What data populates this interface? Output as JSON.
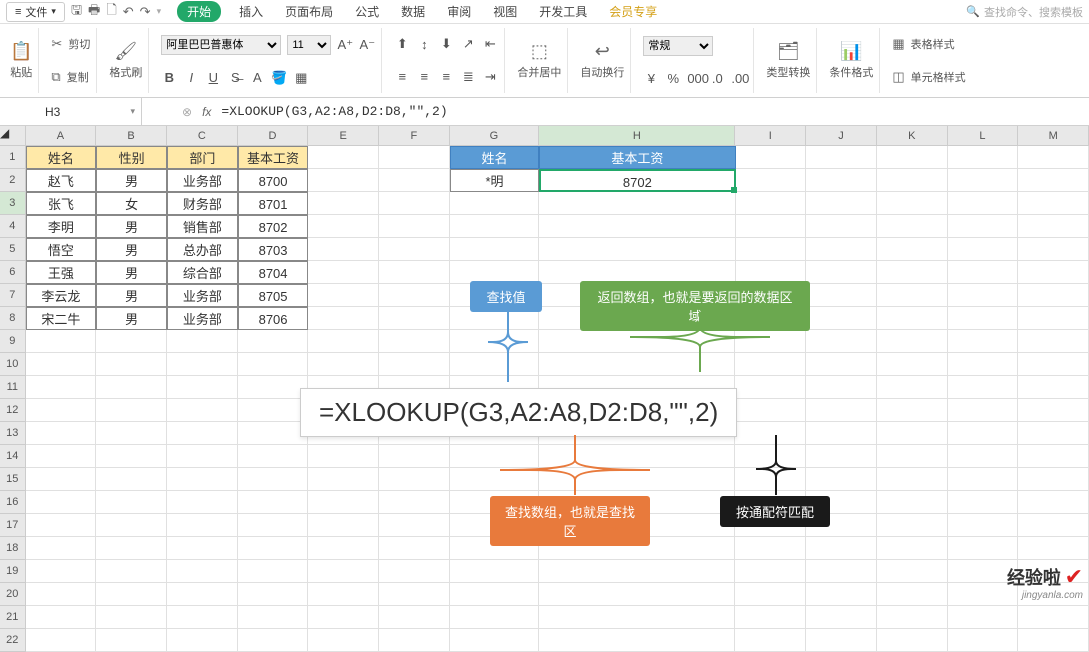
{
  "menu": {
    "file": "文件",
    "tabs": [
      "开始",
      "插入",
      "页面布局",
      "公式",
      "数据",
      "审阅",
      "视图",
      "开发工具",
      "会员专享"
    ],
    "search": "查找命令、搜索模板"
  },
  "ribbon": {
    "paste": "粘贴",
    "cut": "剪切",
    "copy": "复制",
    "fmt": "格式刷",
    "font_name": "阿里巴巴普惠体",
    "font_size": "11",
    "merge": "合并居中",
    "wrap": "自动换行",
    "numfmt": "常规",
    "typeconv": "类型转换",
    "condfmt": "条件格式",
    "tablestyle": "表格样式",
    "cellstyle": "单元格样式"
  },
  "ref": {
    "name": "H3",
    "formula": "=XLOOKUP(G3,A2:A8,D2:D8,\"\",2)"
  },
  "cols": [
    "A",
    "B",
    "C",
    "D",
    "E",
    "F",
    "G",
    "H",
    "I",
    "J",
    "K",
    "L",
    "M"
  ],
  "table": {
    "headers": [
      "姓名",
      "性别",
      "部门",
      "基本工资"
    ],
    "rows": [
      [
        "赵飞",
        "男",
        "业务部",
        "8700"
      ],
      [
        "张飞",
        "女",
        "财务部",
        "8701"
      ],
      [
        "李明",
        "男",
        "销售部",
        "8702"
      ],
      [
        "悟空",
        "男",
        "总办部",
        "8703"
      ],
      [
        "王强",
        "男",
        "综合部",
        "8704"
      ],
      [
        "李云龙",
        "男",
        "业务部",
        "8705"
      ],
      [
        "宋二牛",
        "男",
        "业务部",
        "8706"
      ]
    ]
  },
  "lookup": {
    "h_name": "姓名",
    "h_sal": "基本工资",
    "v_name": "*明",
    "v_sal": "8702"
  },
  "callouts": {
    "lookup_value": "查找值",
    "return_array": "返回数组，也就是要返回的数据区域",
    "lookup_array": "查找数组，也就是查找区",
    "wildcard": "按通配符匹配",
    "formula": "=XLOOKUP(G3,A2:A8,D2:D8,\"\",2)"
  },
  "watermark": {
    "text": "经验啦",
    "url": "jingyanla.com"
  }
}
